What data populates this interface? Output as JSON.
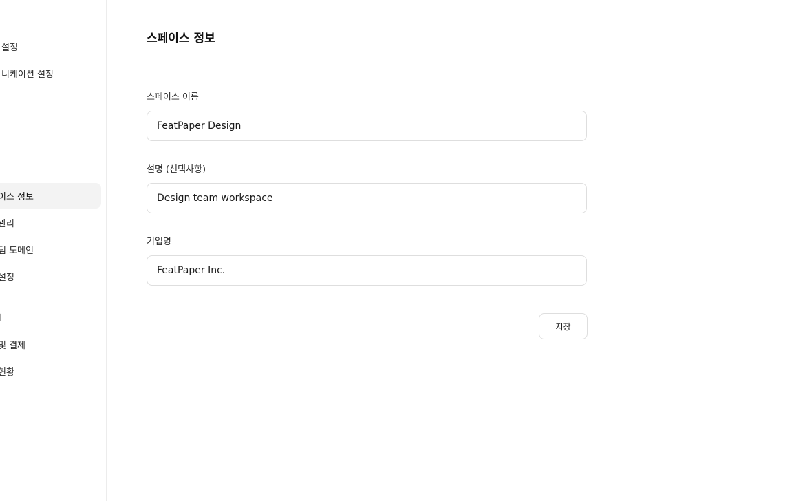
{
  "sidebar": {
    "top_items": [
      {
        "label": "설정"
      },
      {
        "label": "니케이션 설정"
      }
    ],
    "items": [
      {
        "label": "이스 정보",
        "active": true
      },
      {
        "label": "관리"
      },
      {
        "label": "텀 도메인"
      },
      {
        "label": "설정"
      }
    ],
    "section_label": "제",
    "billing_items": [
      {
        "label": "및 결제"
      },
      {
        "label": "현황"
      }
    ]
  },
  "main": {
    "title": "스페이스 정보",
    "fields": [
      {
        "label": "스페이스 이름",
        "value": "FeatPaper Design"
      },
      {
        "label": "설명 (선택사항)",
        "value": "Design team workspace"
      },
      {
        "label": "기업명",
        "value": "FeatPaper Inc."
      }
    ],
    "save_label": "저장"
  }
}
